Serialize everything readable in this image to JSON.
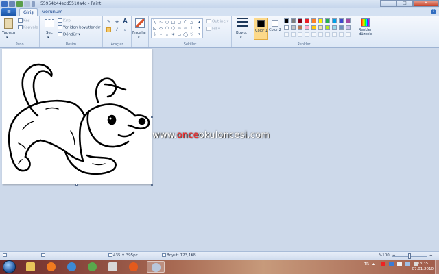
{
  "window": {
    "title": "55954b44ecd5510a4c - Paint",
    "minimize": "–",
    "maximize": "□",
    "close": "✕"
  },
  "tabs": {
    "file": "≡",
    "home": "Giriş",
    "view": "Görünüm"
  },
  "clipboard": {
    "paste": "Yapıştır",
    "cut": "Kes",
    "copy": "Kopyala",
    "label": "Pano"
  },
  "image": {
    "select": "Seç",
    "crop": "Kırp",
    "resize": "Yeniden boyutlandır",
    "rotate": "Döndür",
    "label": "Resim"
  },
  "tools": {
    "label": "Araçlar",
    "text_tool": "A"
  },
  "brushes": {
    "label": "Fırçalar"
  },
  "shapes": {
    "outline": "Outline",
    "fill": "Fill",
    "label": "Şekiller"
  },
  "size": {
    "label": "Boyut"
  },
  "colors": {
    "color1_label": "Color 1",
    "color2_label": "Color 2",
    "edit_colors": "Renkleri düzenle",
    "label": "Renkler",
    "color1_value": "#000000",
    "color2_value": "#ffffff",
    "palette_row1": [
      "#000000",
      "#7f7f7f",
      "#880015",
      "#ed1c24",
      "#ff7f27",
      "#fff200",
      "#22b14c",
      "#00a2e8",
      "#3f48cc",
      "#a349a4"
    ],
    "palette_row2": [
      "#ffffff",
      "#c3c3c3",
      "#b97a57",
      "#ffaec9",
      "#ffc90e",
      "#efe4b0",
      "#b5e61d",
      "#99d9ea",
      "#7092be",
      "#c8bfe7"
    ]
  },
  "watermark": {
    "prefix": "www.",
    "accent": "once",
    "suffix": "okuloncesi.com"
  },
  "status": {
    "dimensions": "435 × 395px",
    "filesize": "Boyut: 123,1KB",
    "zoom": "%100"
  },
  "taskbar": {
    "language": "TR",
    "time": "18:35",
    "date": "07.01.2010"
  }
}
